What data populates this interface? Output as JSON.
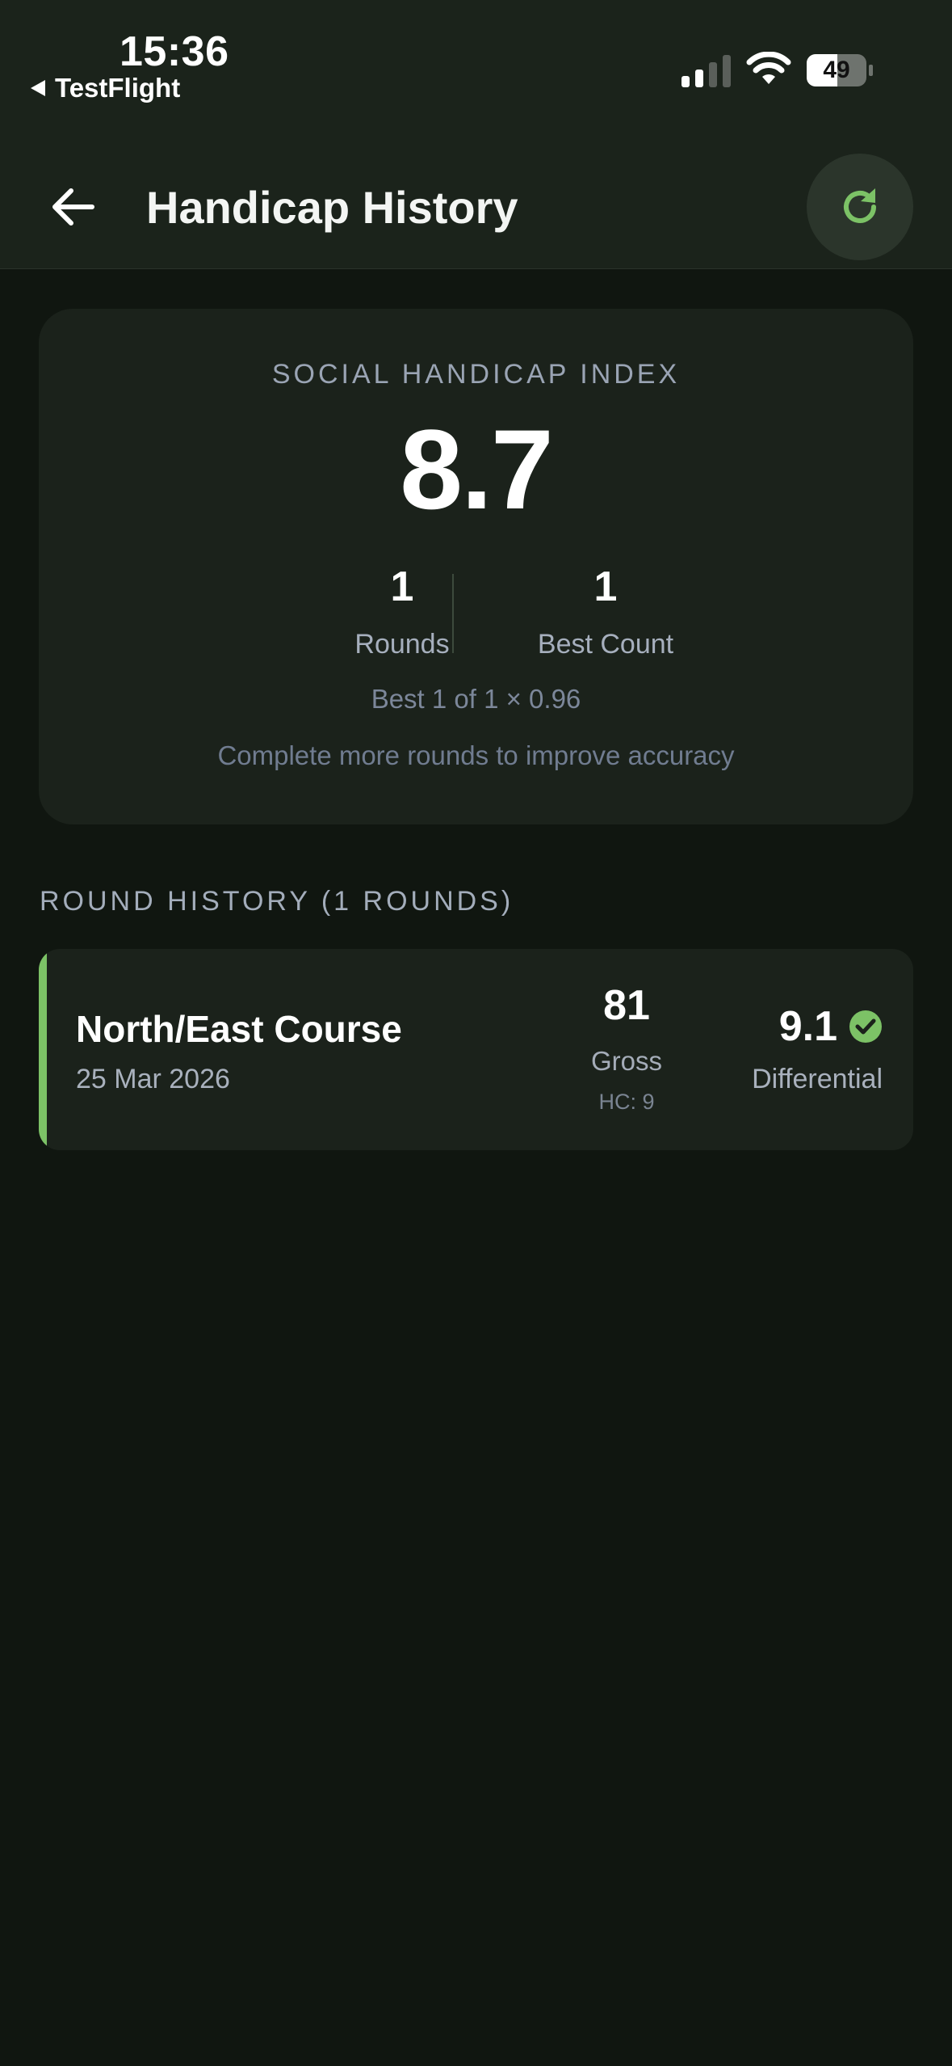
{
  "status_bar": {
    "time": "15:36",
    "back_app": "TestFlight",
    "battery": "49"
  },
  "header": {
    "title": "Handicap History"
  },
  "index_card": {
    "caption": "SOCIAL HANDICAP INDEX",
    "value": "8.7",
    "rounds_value": "1",
    "rounds_label": "Rounds",
    "best_count_value": "1",
    "best_count_label": "Best Count",
    "formula": "Best 1 of 1 × 0.96",
    "hint": "Complete more rounds to improve accuracy"
  },
  "round_history": {
    "title": "ROUND HISTORY (1 ROUNDS)",
    "rounds": [
      {
        "course": "North/East Course",
        "date": "25 Mar 2026",
        "gross": "81",
        "gross_label": "Gross",
        "hc": "HC: 9",
        "differential": "9.1",
        "differential_label": "Differential"
      }
    ]
  },
  "colors": {
    "accent": "#7cc266",
    "background": "#101610",
    "card": "#1b221b"
  },
  "icons": {
    "back": "arrow-left-icon",
    "refresh": "refresh-icon",
    "counted": "check-circle-icon"
  }
}
